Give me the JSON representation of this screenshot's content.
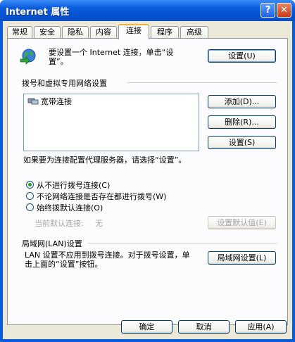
{
  "window": {
    "title": "Internet 属性",
    "help_glyph": "?",
    "close_glyph": "✕"
  },
  "tabs": [
    {
      "label": "常规"
    },
    {
      "label": "安全"
    },
    {
      "label": "隐私"
    },
    {
      "label": "内容"
    },
    {
      "label": "连接",
      "active": true
    },
    {
      "label": "程序"
    },
    {
      "label": "高级"
    }
  ],
  "setup": {
    "text": "要设置一个 Internet 连接，单击“设置”。",
    "button": "设置(U)"
  },
  "dialup": {
    "heading": "拨号和虚拟专用网络设置",
    "items": [
      "宽带连接"
    ],
    "add_button": "添加(D)...",
    "remove_button": "删除(R)...",
    "settings_button": "设置(S)",
    "proxy_text": "如果要为连接配置代理服务器，请选择“设置”。",
    "options": [
      {
        "label": "从不进行拨号连接(C)",
        "checked": true
      },
      {
        "label": "不论网络连接是否存在都进行拨号(W)",
        "checked": false
      },
      {
        "label": "始终拨默认连接(O)",
        "checked": false
      }
    ],
    "default_label": "当前默认连接:",
    "default_value": "无",
    "set_default_button": "设置默认值(E)"
  },
  "lan": {
    "heading": "局域网(LAN)设置",
    "text": "LAN 设置不应用到拨号连接。对于拨号设置，单击上面的“设置”按钮。",
    "button": "局域网设置(L)"
  },
  "footer": {
    "ok": "确定",
    "cancel": "取消",
    "apply": "应用(A)"
  }
}
